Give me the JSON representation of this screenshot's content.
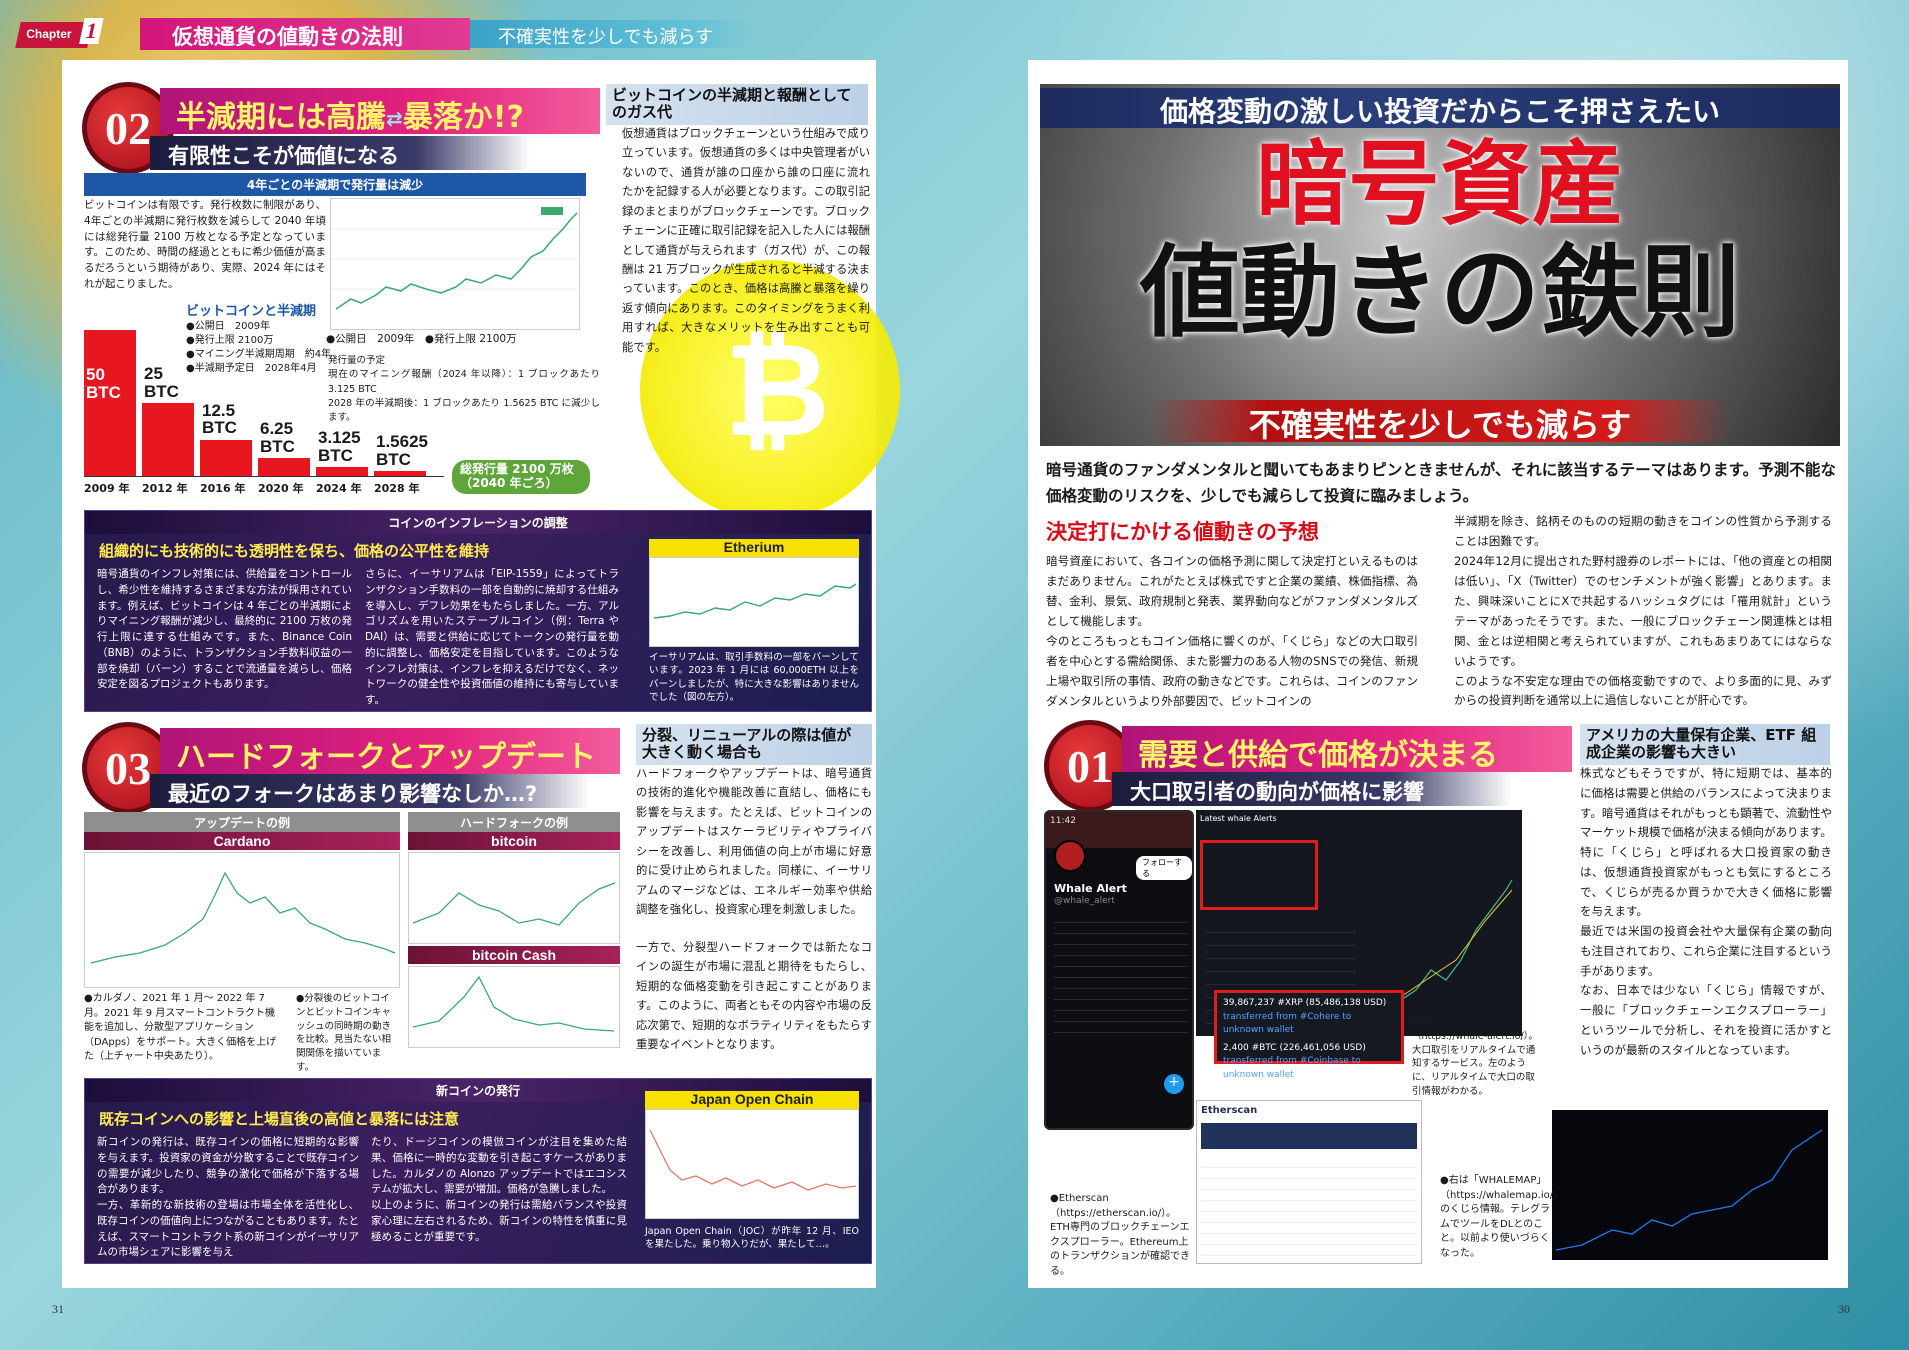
{
  "header": {
    "chapter_label": "Chapter",
    "chapter_num": "1",
    "title": "仮想通貨の値動きの法則",
    "subtitle": "不確実性を少しでも減らす"
  },
  "sec02": {
    "num": "02",
    "head_a": "半減期には高騰",
    "head_arrow": "⇄",
    "head_b": "暴落か!?",
    "sub": "有限性こそが価値になる",
    "bar_title": "4年ごとの半減期で発行量は減少",
    "intro": "ビットコインは有限です。発行枚数に制限があり、4年ごとの半減期に発行枚数を減らして 2040 年頃には総発行量 2100 万枚となる予定となっています。このため、時間の経過とともに希少価値が高まるだろうという期待があり、実際、2024 年にはそれが起こりました。",
    "btc_title": "ビットコインと半減期",
    "btc_facts": [
      "●公開日　2009年",
      "●発行上限 2100万",
      "●マイニング半減期周期　約4年",
      "●半減期予定日　2028年4月"
    ],
    "chart_caption": "●公開日　2009年　●発行上限 2100万",
    "schedule": "発行量の予定\n現在のマイニング報酬（2024 年以降）：1 ブロックあたり 3.125 BTC\n2028 年の半減期後：1 ブロックあたり 1.5625 BTC に減少します。",
    "total_label": "総発行量 2100 万枚\n（2040 年ごろ）",
    "side_head": "ビットコインの半減期と報酬としてのガス代",
    "side_text": "仮想通貨はブロックチェーンという仕組みで成り立っています。仮想通貨の多くは中央管理者がいないので、通貨が誰の口座から誰の口座に流れたかを記録する人が必要となります。この取引記録のまとまりがブロックチェーンです。ブロックチェーンに正確に取引記録を記入した人には報酬として通貨が与えられます（ガス代）が、この報酬は 21 万ブロックが生成されると半減する決まっています。このとき、価格は高騰と暴落を繰り返す傾向にあります。このタイミングをうまく利用すれば、大きなメリットを生み出すことも可能です。"
  },
  "chart_data": [
    {
      "type": "bar",
      "title": "",
      "categories": [
        "2009 年",
        "2012 年",
        "2016 年",
        "2020 年",
        "2024 年",
        "2028 年"
      ],
      "values": [
        50,
        25,
        12.5,
        6.25,
        3.125,
        1.5625
      ],
      "labels": [
        "50\nBTC",
        "25\nBTC",
        "12.5\nBTC",
        "6.25\nBTC",
        "3.125\nBTC",
        "1.5625\nBTC"
      ],
      "xlabel": "",
      "ylabel": "",
      "ylim": [
        0,
        50
      ]
    }
  ],
  "inflation": {
    "bar": "コインのインフレーションの調整",
    "title": "組織的にも技術的にも透明性を保ち、価格の公平性を維持",
    "col1": "暗号通貨のインフレ対策には、供給量をコントロールし、希少性を維持するさまざまな方法が採用されています。例えば、ビットコインは 4 年ごとの半減期によりマイニング報酬が減少し、最終的に 2100 万枚の発行上限に達する仕組みです。また、Binance Coin（BNB）のように、トランザクション手数料収益の一部を焼却（バーン）することで流通量を減らし、価格安定を図るプロジェクトもあります。",
    "col2": "さらに、イーサリアムは「EIP-1559」によってトランザクション手数料の一部を自動的に焼却する仕組みを導入し、デフレ効果をもたらしました。一方、アルゴリズムを用いたステーブルコイン（例：Terra や DAI）は、需要と供給に応じてトークンの発行量を動的に調整し、価格安定を目指しています。このようなインフレ対策は、インフレを抑えるだけでなく、ネットワークの健全性や投資価値の維持にも寄与しています。",
    "eth_label": "Etherium",
    "eth_cap": "イーサリアムは、取引手数料の一部をバーンしています。2023 年 1 月には 60,000ETH 以上をバーンしましたが、特に大きな影響はありませんでした（図の左方）。"
  },
  "sec03": {
    "num": "03",
    "head": "ハードフォークとアップデート",
    "sub": "最近のフォークはあまり影響なしか…?",
    "upd_label": "アップデートの例",
    "fork_label": "ハードフォークの例",
    "cardano": "Cardano",
    "bitcoin": "bitcoin",
    "bcash": "bitcoin Cash",
    "cap1": "●カルダノ、2021 年 1 月〜 2022 年 7 月。2021 年 9 月スマートコントラクト機能を追加し、分散型アプリケーション（DApps）をサポート。大きく価格を上げた（上チャート中央あたり）。",
    "cap2": "●分裂後のビットコインとビットコインキャッシュの同時期の動きを比較。見当たない相関関係を描いています。",
    "side_head": "分裂、リニューアルの際は値が大きく動く場合も",
    "side_text1": "ハードフォークやアップデートは、暗号通貨の技術的進化や機能改善に直結し、価格にも影響を与えます。たとえば、ビットコインのアップデートはスケーラビリティやプライバシーを改善し、利用価値の向上が市場に好意的に受け止められました。同様に、イーサリアムのマージなどは、エネルギー効率や供給調整を強化し、投資家心理を刺激しました。",
    "side_text2": "一方で、分裂型ハードフォークでは新たなコインの誕生が市場に混乱と期待をもたらし、短期的な価格変動を引き起こすことがあります。このように、両者ともその内容や市場の反応次第で、短期的なボラティリティをもたらす重要なイベントとなります。"
  },
  "newcoin": {
    "bar": "新コインの発行",
    "title": "既存コインへの影響と上場直後の高値と暴落には注意",
    "col1": "新コインの発行は、既存コインの価格に短期的な影響を与えます。投資家の資金が分散することで既存コインの需要が減少したり、競争の激化で価格が下落する場合があります。\n一方、革新的な新技術の登場は市場全体を活性化し、既存コインの価値向上につながることもあります。たとえば、スマートコントラクト系の新コインがイーサリアムの市場シェアに影響を与え",
    "col2": "たり、ドージコインの模倣コインが注目を集めた結果、価格に一時的な変動を引き起こすケースがありました。カルダノの Alonzo アップデートではエコシステムが拡大し、需要が増加。価格が急騰しました。\n以上のように、新コインの発行は需給バランスや投資家心理に左右されるため、新コインの特性を慎重に見極めることが重要です。",
    "joc_label": "Japan Open Chain",
    "joc_cap": "Japan Open Chain（JOC）が昨年 12 月、IEO を果たした。乗り物入りだが、果たして…。"
  },
  "feature": {
    "banner": "価格変動の激しい投資だからこそ押さえたい",
    "title1": "暗号資産",
    "title2": "値動きの鉄則",
    "subtitle": "不確実性を少しでも減らす",
    "lead": "暗号通貨のファンダメンタルと聞いてもあまりピンときませんが、それに該当するテーマはあります。予測不能な価格変動のリスクを、少しでも減らして投資に臨みましょう。",
    "h": "決定打にかける値動きの予想",
    "c1": "暗号資産において、各コインの価格予測に関して決定打といえるものはまだありません。これがたとえば株式ですと企業の業績、株価指標、為替、金利、景気、政府規制と発表、業界動向などがファンダメンタルズとして機能します。\n今のところもっともコイン価格に響くのが、「くじら」などの大口取引者を中心とする需給関係、また影響力のある人物のSNSでの発信、新規上場や取引所の事情、政府の動きなどです。これらは、コインのファンダメンタルというより外部要因で、ビットコインの",
    "c2": "半減期を除き、銘柄そのものの短期の動きをコインの性質から予測することは困難です。\n2024年12月に提出された野村證券のレポートには、「他の資産との相関は低い」、「X（Twitter）でのセンチメントが強く影響」とあります。また、興味深いことにXで共起するハッシュタグには「罹用就計」というテーマがあったそうです。また、一般にブロックチェーン関連株とは相関、金とは逆相関と考えられていますが、これもあまりあてにはならないようです。\nこのような不安定な理由での価格変動ですので、より多面的に見、みずからの投資判断を通常以上に過信しないことが肝心です。"
  },
  "sec01": {
    "num": "01",
    "head": "需要と供給で価格が決まる",
    "sub": "大口取引者の動向が価格に影響",
    "side_head": "アメリカの大量保有企業、ETF 組成企業の影響も大きい",
    "side_text": "株式などもそうですが、特に短期では、基本的に価格は需要と供給のバランスによって決まります。暗号通貨はそれがもっとも顕著で、流動性やマーケット規模で価格が決まる傾向があります。\n特に「くじら」と呼ばれる大口投資家の動きは、仮想通貨投資家がもっとも気にするところで、くじらが売るか買うかで大きく価格に影響を与えます。\n最近では米国の投資会社や大量保有企業の動向も注目されており、これら企業に注目するという手があります。\nなお、日本では少ない「くじら」情報ですが、一般に「ブロックチェーンエクスプローラー」というツールで分析し、それを投資に活かすというのが最新のスタイルとなっています。",
    "phone_time": "11:42",
    "phone_name": "Whale Alert",
    "phone_handle": "@whale_alert",
    "phone_follow": "フォローする",
    "alert1": "39,867,237 #XRP (85,486,138 USD)",
    "alert1b": "transferred from #Cohere to unknown wallet",
    "alert2": "2,400 #BTC (226,461,056 USD)",
    "alert2b": "transferred from #Coinbase to unknown wallet",
    "dash_title": "Latest whale Alerts",
    "cap_whale": "●Whale Alert（https://whale-alert.io/）。大口取引をリアルタイムで通知するサービス。左のように、リアルタイムで大口の取引情報がわかる。",
    "cap_ether": "●Etherscan（https://etherscan.io/）。ETH専門のブロックチェーンエクスプローラー。Ethereum上のトランザクションが確認できる。",
    "ether_name": "Etherscan",
    "cap_whalemap": "●右は「WHALEMAP」（https://whalemap.io/）のくじら情報。テレグラムでツールをDLとのこと。以前より使いづらくなった。"
  },
  "pages": {
    "left": "31",
    "right": "30"
  }
}
